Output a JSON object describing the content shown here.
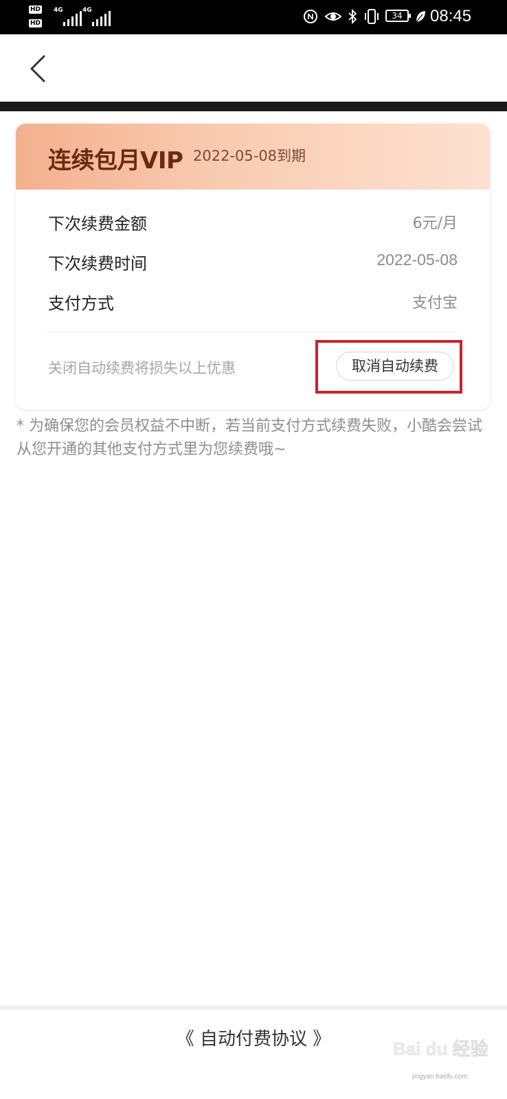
{
  "status_bar": {
    "hd1": "HD",
    "hd2": "HD",
    "signal1_label": "4G",
    "signal2_label": "4G",
    "battery_level": "34",
    "time": "08:45"
  },
  "nav": {
    "back_icon": "chevron-left-icon"
  },
  "card": {
    "title": "连续包月VIP",
    "expire_text": "2022-05-08到期",
    "rows": [
      {
        "label": "下次续费金额",
        "value": "6元/月"
      },
      {
        "label": "下次续费时间",
        "value": "2022-05-08"
      },
      {
        "label": "支付方式",
        "value": "支付宝"
      }
    ],
    "warning": "关闭自动续费将损失以上优惠",
    "cancel_label": "取消自动续费"
  },
  "note": "* 为确保您的会员权益不中断，若当前支付方式续费失败，小酷会尝试从您开通的其他支付方式里为您续费哦~",
  "footer": {
    "agreement_label": "《 自动付费协议 》"
  },
  "watermark": {
    "brand": "Bai du 经验",
    "url": "jingyan.baidu.com"
  },
  "colors": {
    "header_start": "#f4b08e",
    "header_end": "#fde1d1",
    "title": "#6b2a10",
    "highlight": "#d0202a"
  }
}
